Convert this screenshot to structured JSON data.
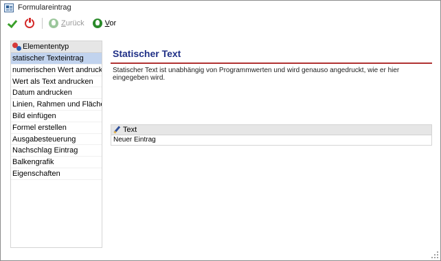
{
  "window": {
    "title": "Formulareintrag"
  },
  "toolbar": {
    "confirm_icon": "check-icon",
    "cancel_icon": "power-icon",
    "back_label_prefix": "Z",
    "back_label_rest": "urück",
    "forward_label_prefix": "V",
    "forward_label_rest": "or"
  },
  "sidebar": {
    "header": "Elemententyp",
    "items": [
      {
        "label": "statischer Texteintrag",
        "selected": true
      },
      {
        "label": "numerischen Wert andrucken"
      },
      {
        "label": "Wert als Text andrucken"
      },
      {
        "label": "Datum andrucken"
      },
      {
        "label": "Linien, Rahmen und Flächen"
      },
      {
        "label": "Bild einfügen"
      },
      {
        "label": "Formel erstellen"
      },
      {
        "label": "Ausgabesteuerung"
      },
      {
        "label": "Nachschlag Eintrag"
      },
      {
        "label": "Balkengrafik"
      },
      {
        "label": "Eigenschaften"
      }
    ]
  },
  "main": {
    "title": "Statischer Text",
    "description": "Statischer Text ist unabhängig von Programmwerten und wird genauso angedruckt, wie er hier eingegeben wird.",
    "grid": {
      "header": "Text",
      "value": "Neuer Eintrag"
    }
  },
  "colors": {
    "title_blue": "#1f2f86",
    "rule_red": "#b03030",
    "selection": "#c1d3ee"
  }
}
